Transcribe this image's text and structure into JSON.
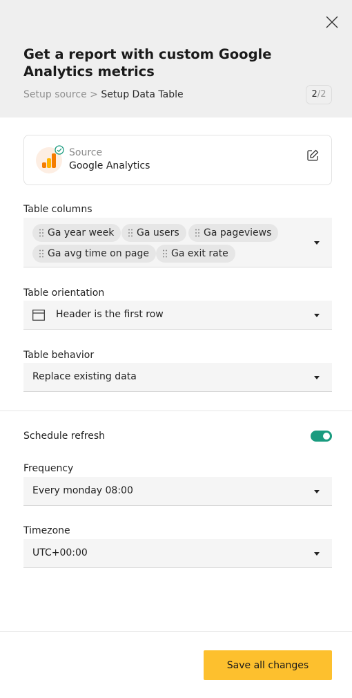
{
  "header": {
    "title": "Get a report with custom Google Analytics metrics",
    "breadcrumb": {
      "previous": "Setup source",
      "separator": ">",
      "current": "Setup Data Table"
    },
    "step": {
      "current": "2",
      "separator": "/",
      "total": "2"
    },
    "close_icon": "close-icon"
  },
  "source": {
    "label": "Source",
    "name": "Google Analytics",
    "logo_icon": "google-analytics-icon",
    "status_icon": "check-circle-icon",
    "edit_icon": "edit-icon",
    "logo_colors": {
      "bar_dark": "#f57c00",
      "bar_light": "#ffb300",
      "logo_bg": "#fdeee3",
      "check": "#1a9b7f"
    }
  },
  "table_columns": {
    "label": "Table columns",
    "chips": [
      "Ga year week",
      "Ga users",
      "Ga pageviews",
      "Ga avg time on page",
      "Ga exit rate"
    ]
  },
  "table_orientation": {
    "label": "Table orientation",
    "value": "Header is the first row",
    "icon": "table-header-icon"
  },
  "table_behavior": {
    "label": "Table behavior",
    "value": "Replace existing data"
  },
  "schedule": {
    "label": "Schedule refresh",
    "enabled": true,
    "toggle_color": "#1a9b7f"
  },
  "frequency": {
    "label": "Frequency",
    "value": "Every monday 08:00"
  },
  "timezone": {
    "label": "Timezone",
    "value": "UTC+00:00"
  },
  "footer": {
    "save_label": "Save all changes",
    "save_color": "#fdc02e"
  }
}
